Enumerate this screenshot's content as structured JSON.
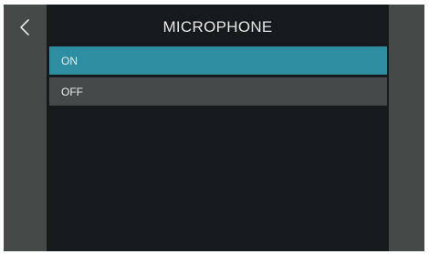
{
  "header": {
    "title": "MICROPHONE",
    "back_icon": "chevron-left-icon"
  },
  "menu": {
    "items": [
      {
        "label": "ON",
        "selected": true
      },
      {
        "label": "OFF",
        "selected": false
      }
    ]
  },
  "colors": {
    "background": "#161a1c",
    "side_panels": "#454948",
    "selected_item": "#2e8ea1",
    "item": "#464949",
    "text": "#e6e8e8"
  }
}
